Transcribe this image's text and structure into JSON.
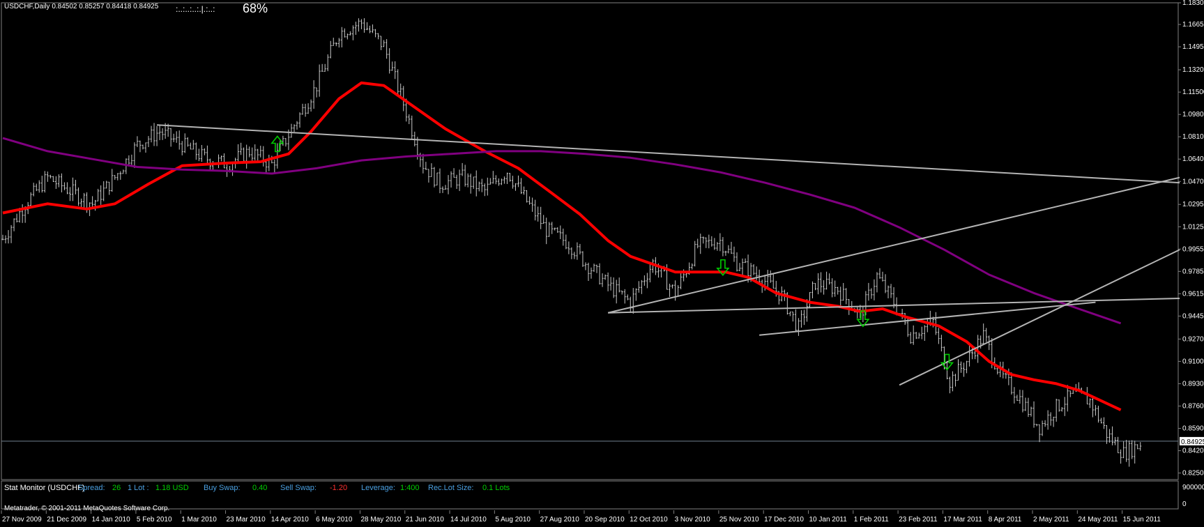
{
  "header": {
    "symbol_info": "USDCHF,Daily  0.84502 0.85257 0.84418 0.84925",
    "indicator_dots": ":..:..:..:.|.:..:",
    "indicator_pct": "68%"
  },
  "stat_monitor": {
    "title": "Stat Monitor (USDCHF)",
    "spread_label": "Spread:",
    "spread_value": "26",
    "lot_label": "1 Lot :",
    "lot_value": "1.18 USD",
    "buyswap_label": "Buy Swap:",
    "buyswap_value": "0.40",
    "sellswap_label": "Sell Swap:",
    "sellswap_value": "-1.20",
    "leverage_label": "Leverage:",
    "leverage_value": "1:400",
    "lotsize_label": "Rec.Lot Size:",
    "lotsize_value": "0.1 Lots"
  },
  "footer": {
    "copyright": "Metatrader, © 2001-2011 MetaQuotes Software Corp."
  },
  "colors": {
    "background": "#000000",
    "bars": "#c8c8c8",
    "ma_fast": "#ff0000",
    "ma_slow": "#800080",
    "trendline": "#b4b4b4",
    "arrow": "#00cc00",
    "stat_label": "#4a9fe0",
    "stat_value_pos": "#00d000",
    "stat_value_neg": "#ff3030"
  },
  "chart_data": {
    "type": "ohlc",
    "symbol": "USDCHF",
    "timeframe": "Daily",
    "ylim": [
      0.82,
      1.183
    ],
    "y_ticks": [
      "1.18300",
      "1.16650",
      "1.14950",
      "1.13200",
      "1.11500",
      "1.09800",
      "1.08100",
      "1.06400",
      "1.04700",
      "1.02950",
      "1.01250",
      "0.99550",
      "0.97850",
      "0.96150",
      "0.94450",
      "0.92700",
      "0.91000",
      "0.89300",
      "0.87600",
      "0.85900",
      "0.84200",
      "0.82500"
    ],
    "current_price": "0.84925",
    "x_ticks": [
      "27 Nov 2009",
      "21 Dec 2009",
      "14 Jan 2010",
      "5 Feb 2010",
      "1 Mar 2010",
      "23 Mar 2010",
      "14 Apr 2010",
      "6 May 2010",
      "28 May 2010",
      "21 Jun 2010",
      "14 Jul 2010",
      "5 Aug 2010",
      "27 Aug 2010",
      "20 Sep 2010",
      "12 Oct 2010",
      "3 Nov 2010",
      "25 Nov 2010",
      "17 Dec 2010",
      "10 Jan 2011",
      "1 Feb 2011",
      "23 Feb 2011",
      "17 Mar 2011",
      "8 Apr 2011",
      "2 May 2011",
      "24 May 2011",
      "15 Jun 2011"
    ],
    "x_tick_index": [
      0,
      16,
      32,
      48,
      64,
      80,
      96,
      112,
      128,
      144,
      160,
      176,
      192,
      208,
      224,
      240,
      256,
      272,
      288,
      304,
      320,
      336,
      352,
      368,
      384,
      400
    ],
    "price_keypoints": [
      [
        0,
        1.003
      ],
      [
        8,
        1.03
      ],
      [
        16,
        1.05
      ],
      [
        24,
        1.04
      ],
      [
        32,
        1.03
      ],
      [
        40,
        1.05
      ],
      [
        48,
        1.075
      ],
      [
        56,
        1.085
      ],
      [
        64,
        1.075
      ],
      [
        72,
        1.065
      ],
      [
        80,
        1.06
      ],
      [
        88,
        1.07
      ],
      [
        96,
        1.06
      ],
      [
        104,
        1.09
      ],
      [
        112,
        1.12
      ],
      [
        120,
        1.16
      ],
      [
        128,
        1.168
      ],
      [
        136,
        1.15
      ],
      [
        144,
        1.1
      ],
      [
        150,
        1.06
      ],
      [
        156,
        1.045
      ],
      [
        164,
        1.05
      ],
      [
        172,
        1.04
      ],
      [
        180,
        1.055
      ],
      [
        186,
        1.035
      ],
      [
        194,
        1.01
      ],
      [
        202,
        1.0
      ],
      [
        208,
        0.985
      ],
      [
        216,
        0.968
      ],
      [
        224,
        0.955
      ],
      [
        232,
        0.985
      ],
      [
        240,
        0.962
      ],
      [
        248,
        0.998
      ],
      [
        256,
        1.002
      ],
      [
        262,
        0.985
      ],
      [
        270,
        0.975
      ],
      [
        278,
        0.96
      ],
      [
        284,
        0.935
      ],
      [
        290,
        0.97
      ],
      [
        298,
        0.965
      ],
      [
        306,
        0.945
      ],
      [
        312,
        0.975
      ],
      [
        318,
        0.955
      ],
      [
        324,
        0.93
      ],
      [
        332,
        0.94
      ],
      [
        338,
        0.895
      ],
      [
        344,
        0.91
      ],
      [
        350,
        0.93
      ],
      [
        356,
        0.9
      ],
      [
        362,
        0.885
      ],
      [
        370,
        0.86
      ],
      [
        376,
        0.875
      ],
      [
        382,
        0.885
      ],
      [
        388,
        0.88
      ],
      [
        394,
        0.855
      ],
      [
        400,
        0.84
      ],
      [
        406,
        0.847
      ]
    ],
    "series": [
      {
        "name": "",
        "kind": "moving_average",
        "points": [
          [
            0,
            1.023
          ],
          [
            16,
            1.03
          ],
          [
            30,
            1.026
          ],
          [
            40,
            1.03
          ],
          [
            52,
            1.045
          ],
          [
            64,
            1.059
          ],
          [
            80,
            1.061
          ],
          [
            92,
            1.062
          ],
          [
            102,
            1.068
          ],
          [
            110,
            1.085
          ],
          [
            120,
            1.11
          ],
          [
            128,
            1.122
          ],
          [
            136,
            1.12
          ],
          [
            146,
            1.105
          ],
          [
            158,
            1.087
          ],
          [
            172,
            1.07
          ],
          [
            184,
            1.057
          ],
          [
            196,
            1.038
          ],
          [
            206,
            1.022
          ],
          [
            216,
            1.002
          ],
          [
            224,
            0.99
          ],
          [
            232,
            0.984
          ],
          [
            240,
            0.978
          ],
          [
            250,
            0.978
          ],
          [
            258,
            0.978
          ],
          [
            266,
            0.974
          ],
          [
            276,
            0.962
          ],
          [
            288,
            0.955
          ],
          [
            298,
            0.952
          ],
          [
            306,
            0.948
          ],
          [
            314,
            0.95
          ],
          [
            322,
            0.944
          ],
          [
            334,
            0.937
          ],
          [
            344,
            0.925
          ],
          [
            352,
            0.91
          ],
          [
            360,
            0.9
          ],
          [
            368,
            0.896
          ],
          [
            376,
            0.893
          ],
          [
            384,
            0.888
          ],
          [
            392,
            0.88
          ],
          [
            399,
            0.873
          ]
        ]
      },
      {
        "name": "",
        "kind": "moving_average",
        "points": [
          [
            0,
            1.08
          ],
          [
            16,
            1.07
          ],
          [
            32,
            1.064
          ],
          [
            48,
            1.058
          ],
          [
            64,
            1.056
          ],
          [
            80,
            1.055
          ],
          [
            96,
            1.053
          ],
          [
            112,
            1.057
          ],
          [
            128,
            1.063
          ],
          [
            144,
            1.066
          ],
          [
            160,
            1.068
          ],
          [
            176,
            1.07
          ],
          [
            192,
            1.07
          ],
          [
            208,
            1.068
          ],
          [
            224,
            1.065
          ],
          [
            240,
            1.06
          ],
          [
            256,
            1.054
          ],
          [
            272,
            1.046
          ],
          [
            288,
            1.037
          ],
          [
            304,
            1.027
          ],
          [
            320,
            1.012
          ],
          [
            336,
            0.995
          ],
          [
            352,
            0.976
          ],
          [
            368,
            0.962
          ],
          [
            384,
            0.95
          ],
          [
            399,
            0.939
          ]
        ]
      }
    ],
    "trendlines": [
      [
        [
          55,
          1.09
        ],
        [
          420,
          1.046
        ]
      ],
      [
        [
          216,
          0.947
        ],
        [
          420,
          1.05
        ]
      ],
      [
        [
          216,
          0.947
        ],
        [
          420,
          0.958
        ]
      ],
      [
        [
          270,
          0.93
        ],
        [
          390,
          0.955
        ]
      ],
      [
        [
          320,
          0.892
        ],
        [
          420,
          0.995
        ]
      ]
    ],
    "signals": [
      {
        "index": 98,
        "price": 1.075,
        "direction": "up"
      },
      {
        "index": 257,
        "price": 0.982,
        "direction": "down"
      },
      {
        "index": 307,
        "price": 0.943,
        "direction": "down"
      },
      {
        "index": 337,
        "price": 0.91,
        "direction": "down"
      }
    ],
    "sub_ylim_label": "900000",
    "sub_ylim_label_bottom": "0"
  }
}
